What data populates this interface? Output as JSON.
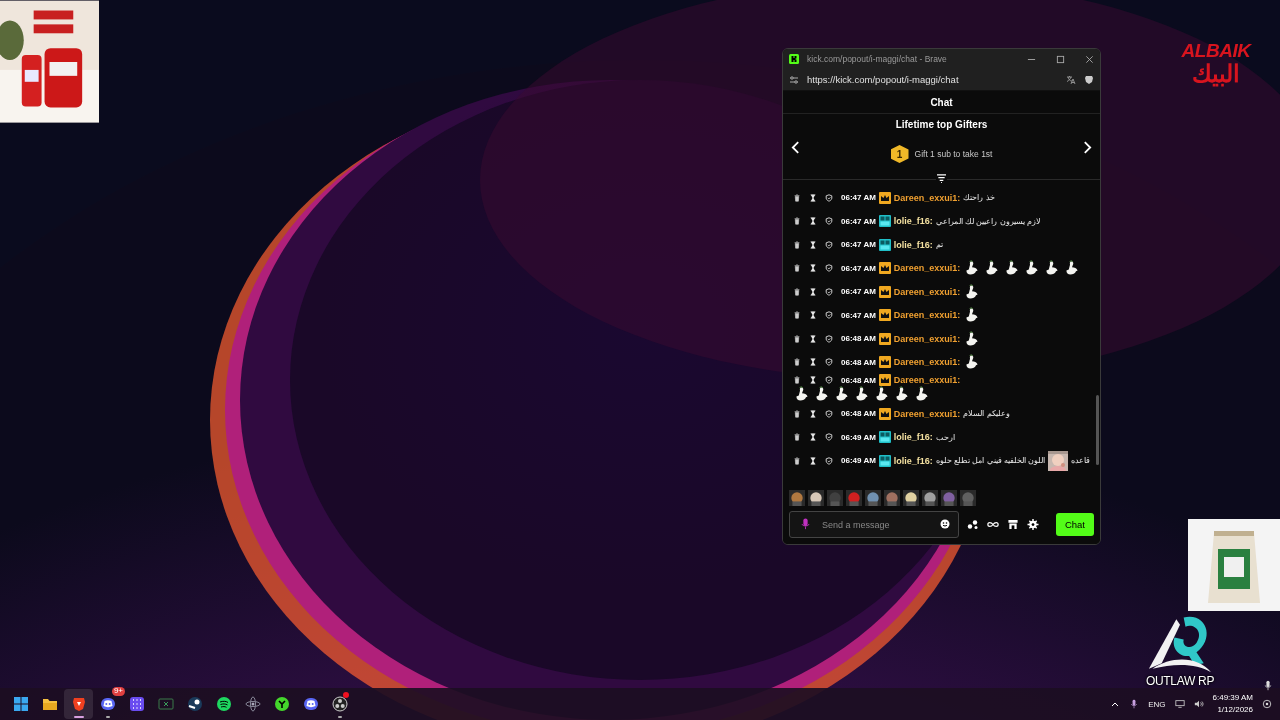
{
  "overlays": {
    "logo_latin": "ALBAIK",
    "logo_arabic": "البيك",
    "brand": "OUTLAW RP"
  },
  "browser": {
    "title": "kick.com/popout/i-maggi/chat - Brave",
    "url": "https://kick.com/popout/i-maggi/chat"
  },
  "chat": {
    "header": "Chat",
    "gifters": {
      "title": "Lifetime top Gifters",
      "rank": "1",
      "text": "Gift 1 sub to take 1st"
    },
    "messages": [
      {
        "time": "06:47 AM",
        "kind": "crown",
        "user": "Dareen_exxui1:",
        "color": "#f0a030",
        "parts": [
          {
            "kind": "text",
            "text": "خذ راحتك"
          }
        ]
      },
      {
        "time": "06:47 AM",
        "kind": "og",
        "user": "lolie_f16:",
        "color": "#f3e0a0",
        "parts": [
          {
            "kind": "text",
            "text": "لازم يسيرون راعيين لك المراعي"
          }
        ]
      },
      {
        "time": "06:47 AM",
        "kind": "og",
        "user": "lolie_f16:",
        "color": "#f3e0a0",
        "parts": [
          {
            "kind": "text",
            "text": "تم"
          }
        ]
      },
      {
        "time": "06:47 AM",
        "kind": "crown",
        "user": "Dareen_exxui1:",
        "color": "#f0a030",
        "parts": [
          {
            "kind": "emote"
          },
          {
            "kind": "emote"
          },
          {
            "kind": "emote"
          },
          {
            "kind": "emote"
          },
          {
            "kind": "emote"
          },
          {
            "kind": "emote"
          }
        ]
      },
      {
        "time": "06:47 AM",
        "kind": "crown",
        "user": "Dareen_exxui1:",
        "color": "#f0a030",
        "parts": [
          {
            "kind": "emote"
          }
        ]
      },
      {
        "time": "06:47 AM",
        "kind": "crown",
        "user": "Dareen_exxui1:",
        "color": "#f0a030",
        "parts": [
          {
            "kind": "emote"
          }
        ]
      },
      {
        "time": "06:48 AM",
        "kind": "crown",
        "user": "Dareen_exxui1:",
        "color": "#f0a030",
        "parts": [
          {
            "kind": "emote"
          }
        ]
      },
      {
        "time": "06:48 AM",
        "kind": "crown",
        "user": "Dareen_exxui1:",
        "color": "#f0a030",
        "parts": [
          {
            "kind": "emote"
          }
        ]
      },
      {
        "time": "06:48 AM",
        "kind": "crown",
        "user": "Dareen_exxui1:",
        "color": "#f0a030",
        "parts": [
          {
            "kind": "emote"
          },
          {
            "kind": "emote"
          },
          {
            "kind": "emote"
          },
          {
            "kind": "emote"
          },
          {
            "kind": "emote"
          },
          {
            "kind": "emote"
          },
          {
            "kind": "emote"
          }
        ]
      },
      {
        "time": "06:48 AM",
        "kind": "crown",
        "user": "Dareen_exxui1:",
        "color": "#f0a030",
        "parts": [
          {
            "kind": "text",
            "text": "وعليكم السلام"
          }
        ]
      },
      {
        "time": "06:49 AM",
        "kind": "og",
        "user": "lolie_f16:",
        "color": "#f3e0a0",
        "parts": [
          {
            "kind": "text",
            "text": "ارحب"
          }
        ]
      },
      {
        "time": "06:49 AM",
        "kind": "og",
        "user": "lolie_f16:",
        "color": "#f3e0a0",
        "parts": [
          {
            "kind": "text",
            "text": "قاعده"
          },
          {
            "kind": "picture"
          },
          {
            "kind": "text",
            "text": "اللون الخلفيه فيني امل تطلع حلوه"
          }
        ]
      }
    ],
    "input": {
      "placeholder": "Send a message"
    },
    "send": "Chat"
  },
  "taskbar": {
    "apps": [
      {
        "kind": "windows",
        "selected": false,
        "running": false
      },
      {
        "kind": "folder",
        "selected": false,
        "running": false
      },
      {
        "kind": "brave",
        "selected": true,
        "running": true
      },
      {
        "kind": "discord",
        "selected": false,
        "running": true,
        "badge": "9+"
      },
      {
        "kind": "grid",
        "selected": false,
        "running": false
      },
      {
        "kind": "excel",
        "selected": false,
        "running": false
      },
      {
        "kind": "steam",
        "selected": false,
        "running": false
      },
      {
        "kind": "spotify",
        "selected": false,
        "running": false
      },
      {
        "kind": "atom",
        "selected": false,
        "running": false
      },
      {
        "kind": "razer",
        "selected": false,
        "running": false
      },
      {
        "kind": "discord",
        "selected": false,
        "running": false
      },
      {
        "kind": "obs",
        "selected": false,
        "running": true,
        "alert": true
      }
    ],
    "language": "ENG",
    "time": "6:49:39 AM",
    "date": "1/12/2026"
  }
}
